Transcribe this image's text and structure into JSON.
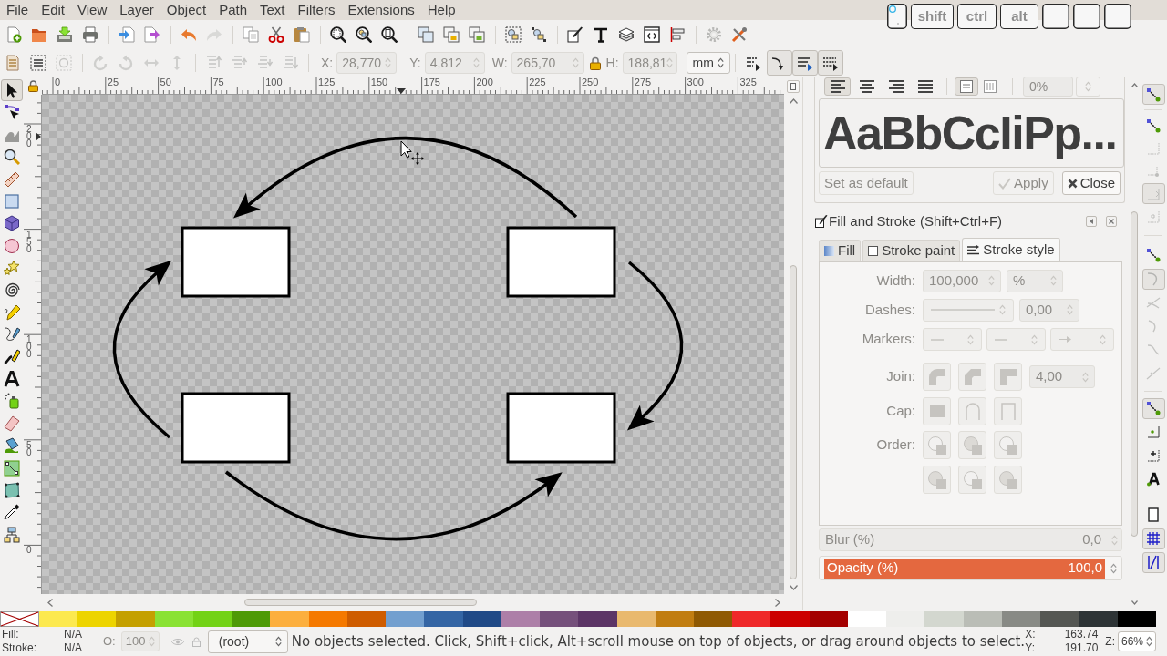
{
  "menubar": {
    "items": [
      "File",
      "Edit",
      "View",
      "Layer",
      "Object",
      "Path",
      "Text",
      "Filters",
      "Extensions",
      "Help"
    ]
  },
  "key_overlay": {
    "keys": [
      {
        "kind": "mouse"
      },
      {
        "kind": "key",
        "label": "shift"
      },
      {
        "kind": "key",
        "label": "ctrl"
      },
      {
        "kind": "key",
        "label": "alt"
      },
      {
        "kind": "blank"
      },
      {
        "kind": "blank"
      },
      {
        "kind": "blank"
      }
    ]
  },
  "selector_toolbar": {
    "fields": [
      {
        "label": "X:",
        "value": "28,770",
        "disabled": true
      },
      {
        "label": "Y:",
        "value": "4,812",
        "disabled": true
      },
      {
        "label": "W:",
        "value": "265,70",
        "disabled": true
      },
      {
        "label": "H:",
        "value": "188,81",
        "disabled": true
      }
    ],
    "unit": "mm",
    "transform_toggles": [
      {
        "on": false
      },
      {
        "on": true
      },
      {
        "on": true
      },
      {
        "on": true
      }
    ]
  },
  "toolbox": {
    "tools": [
      {
        "selected": true
      },
      {
        "selected": false
      },
      {
        "selected": false
      },
      {
        "selected": false
      },
      {
        "selected": false
      },
      {
        "selected": false
      },
      {
        "selected": false
      },
      {
        "selected": false
      },
      {
        "selected": false
      },
      {
        "selected": false
      },
      {
        "selected": false
      },
      {
        "selected": false
      },
      {
        "selected": false
      },
      {
        "selected": false
      },
      {
        "selected": false
      },
      {
        "selected": false
      },
      {
        "selected": false
      },
      {
        "selected": false
      },
      {
        "selected": false
      },
      {
        "selected": false
      },
      {
        "selected": false
      }
    ]
  },
  "rulers": {
    "horizontal": [
      "0",
      "25",
      "50",
      "75",
      "100",
      "125",
      "150",
      "175",
      "200",
      "225",
      "250",
      "275",
      "300",
      "325"
    ],
    "vertical": [
      "200",
      "150",
      "100",
      "50",
      "0"
    ]
  },
  "text_panel": {
    "alignment": [
      {
        "selected": true
      },
      {
        "selected": false
      },
      {
        "selected": false
      },
      {
        "selected": false
      }
    ],
    "writing_mode": [
      {
        "selected": true
      },
      {
        "selected": false
      }
    ],
    "field": {
      "value": "0%",
      "disabled": true
    },
    "preview": "AaBbCcIiPp...",
    "buttons": [
      {
        "kind": "plain",
        "label": "Set as default",
        "disabled": true
      },
      {
        "kind": "apply",
        "label": "Apply",
        "disabled": true
      },
      {
        "kind": "close",
        "label": "Close",
        "disabled": false
      }
    ]
  },
  "fill_stroke": {
    "title": "Fill and Stroke (Shift+Ctrl+F)",
    "tabs": [
      {
        "kind": "fill",
        "label": "Fill",
        "selected": false
      },
      {
        "kind": "stroke_paint",
        "label": "Stroke paint",
        "selected": false
      },
      {
        "kind": "stroke_style",
        "label": "Stroke style",
        "selected": true
      }
    ],
    "width": {
      "label": "Width:",
      "value": "100,000",
      "unit": "%",
      "disabled": true
    },
    "dashes": {
      "label": "Dashes:",
      "value": "0,00",
      "disabled": true
    },
    "markers": {
      "label": "Markers:",
      "disabled": true
    },
    "join": {
      "label": "Join:",
      "value": "4,00",
      "disabled": true
    },
    "cap": {
      "label": "Cap:",
      "disabled": true
    },
    "order": {
      "label": "Order:",
      "disabled": true
    },
    "blur": {
      "label": "Blur (%)",
      "value": "0,0",
      "disabled": true
    },
    "opacity": {
      "label": "Opacity (%)",
      "value": "100,0",
      "level": 1
    }
  },
  "snap_bar": {
    "buttons": [
      {
        "on": true
      },
      {
        "on": false
      },
      {
        "on": false
      },
      {
        "on": false
      },
      {
        "on": true
      },
      {
        "on": false
      },
      {
        "on": false
      },
      {
        "on": true
      },
      {
        "on": false
      },
      {
        "on": false
      },
      {
        "on": false
      },
      {
        "on": false
      },
      {
        "on": true
      },
      {
        "on": false
      },
      {
        "on": false
      },
      {
        "on": false
      },
      {
        "on": false
      },
      {
        "on": true
      },
      {
        "on": true
      }
    ]
  },
  "palette": {
    "swatches": [
      {
        "kind": "none"
      },
      {
        "kind": "color",
        "color": "#fce94f"
      },
      {
        "kind": "color",
        "color": "#edd400"
      },
      {
        "kind": "color",
        "color": "#c4a000"
      },
      {
        "kind": "color",
        "color": "#8ae234"
      },
      {
        "kind": "color",
        "color": "#73d216"
      },
      {
        "kind": "color",
        "color": "#4e9a06"
      },
      {
        "kind": "color",
        "color": "#fcaf3e"
      },
      {
        "kind": "color",
        "color": "#f57900"
      },
      {
        "kind": "color",
        "color": "#ce5c00"
      },
      {
        "kind": "color",
        "color": "#729fcf"
      },
      {
        "kind": "color",
        "color": "#3465a4"
      },
      {
        "kind": "color",
        "color": "#204a87"
      },
      {
        "kind": "color",
        "color": "#ad7fa8"
      },
      {
        "kind": "color",
        "color": "#75507b"
      },
      {
        "kind": "color",
        "color": "#5c3566"
      },
      {
        "kind": "color",
        "color": "#e9b96e"
      },
      {
        "kind": "color",
        "color": "#c17d11"
      },
      {
        "kind": "color",
        "color": "#8f5902"
      },
      {
        "kind": "color",
        "color": "#ef2929"
      },
      {
        "kind": "color",
        "color": "#cc0000"
      },
      {
        "kind": "color",
        "color": "#a40000"
      },
      {
        "kind": "color",
        "color": "#ffffff"
      },
      {
        "kind": "color",
        "color": "#eeeeec"
      },
      {
        "kind": "color",
        "color": "#d3d7cf"
      },
      {
        "kind": "color",
        "color": "#babdb6"
      },
      {
        "kind": "color",
        "color": "#888a85"
      },
      {
        "kind": "color",
        "color": "#555753"
      },
      {
        "kind": "color",
        "color": "#2e3436"
      },
      {
        "kind": "color",
        "color": "#000000"
      }
    ]
  },
  "status_bar": {
    "fill_label": "Fill:",
    "fill_value": "N/A",
    "stroke_label": "Stroke:",
    "stroke_value": "N/A",
    "opacity_label": "O:",
    "opacity_value": "100",
    "opacity_disabled": true,
    "layer": "(root)",
    "message": "No objects selected. Click, Shift+click, Alt+scroll mouse on top of objects, or drag around objects to select.",
    "x_label": "X:",
    "x_value": "163.74",
    "y_label": "Y:",
    "y_value": "191.70",
    "zoom_label": "Z:",
    "zoom_value": "66%"
  }
}
